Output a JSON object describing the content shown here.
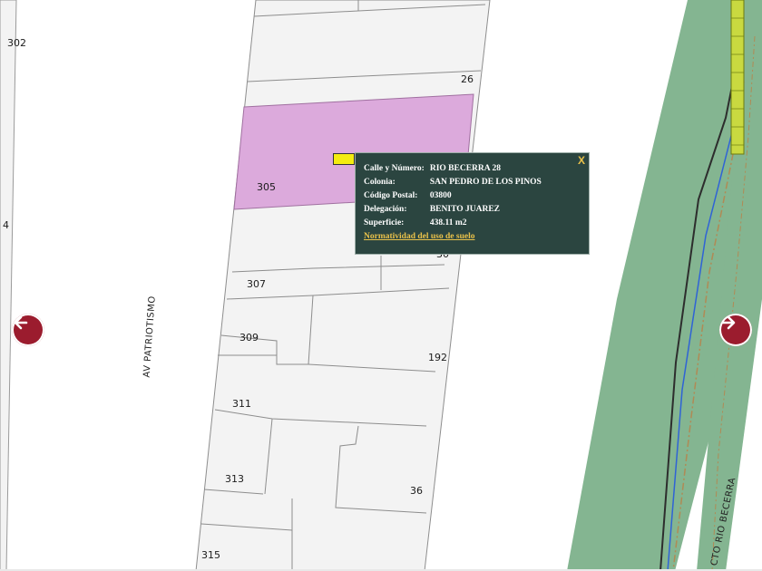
{
  "map": {
    "lot_labels": [
      "302",
      "26",
      "305",
      "307",
      "309",
      "192",
      "311",
      "313",
      "36",
      "315",
      "30",
      "4"
    ],
    "street_labels": [
      "AV PATRIOTISMO",
      "CTO RIO BECERRA"
    ],
    "colors": {
      "selected_lot": "#dcaadc",
      "green_strip": "#84b591",
      "lot_fill": "#f3f3f3",
      "nav_arrow": "#9b1c2e",
      "popup_bg": "#2b4540",
      "popup_link": "#e9c14a",
      "marker": "#f4ec10"
    }
  },
  "popup": {
    "close_label": "X",
    "rows": [
      {
        "key": "Calle y Número:",
        "value": "RIO BECERRA 28"
      },
      {
        "key": "Colonia:",
        "value": "SAN PEDRO DE LOS PINOS"
      },
      {
        "key": "Código Postal:",
        "value": "03800"
      },
      {
        "key": "Delegación:",
        "value": "BENITO JUAREZ"
      },
      {
        "key": "Superficie:",
        "value": "438.11 m2"
      }
    ],
    "link_label": "Normatividad del uso de suelo"
  },
  "nav": {
    "left_icon": "arrow-left-icon",
    "right_icon": "arrow-right-icon"
  }
}
